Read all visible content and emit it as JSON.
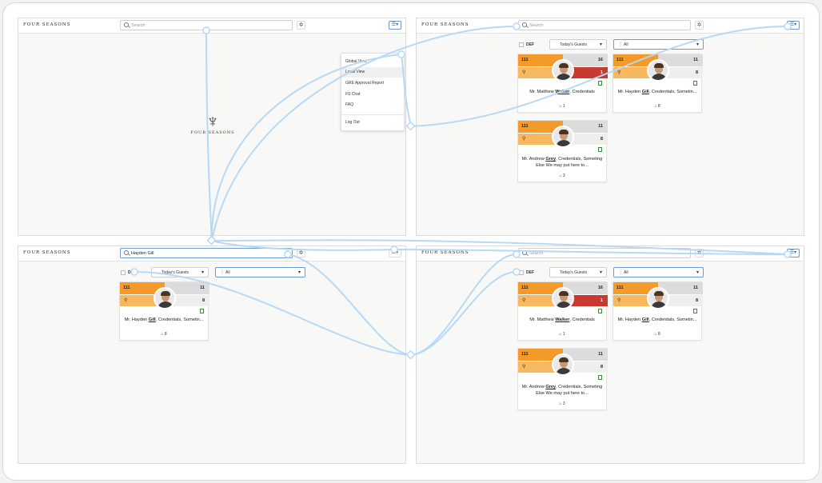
{
  "brand": "FOUR SEASONS",
  "search_placeholder": "Search",
  "search_value_gill": "Hayden Gill",
  "splash_word": "FOUR SEASONS",
  "menu_items": [
    "Global View",
    "Local View",
    "GRE Approval Report",
    "FS Chat",
    "FAQ",
    "Log Out"
  ],
  "filters": {
    "def": "DEF",
    "guests": "Today's Guests",
    "all": "All"
  },
  "cards": {
    "walker": {
      "tl": "111",
      "tr": "16",
      "br": "1",
      "name_pre": "Mr. Matthew ",
      "name_bold": "Walker",
      "name_post": ", Credentials",
      "foot": "1"
    },
    "gill": {
      "tl": "111",
      "tr": "11",
      "br": "8",
      "name_pre": "Mr. Hayden ",
      "name_bold": "Gill",
      "name_post": ", Credentials, Sometin...",
      "foot": "8"
    },
    "grey": {
      "tl": "111",
      "tr": "11",
      "br": "8",
      "name_pre": "Mr. Andrew ",
      "name_bold": "Grey",
      "name_post": ", Credentials, Someting Else We may put here to...",
      "foot": "3"
    }
  },
  "colors": {
    "orange": "#f39a2b",
    "light_orange": "#f7b860",
    "red": "#c83a30",
    "link": "#b7d9f5",
    "accent": "#6a9bd8"
  }
}
